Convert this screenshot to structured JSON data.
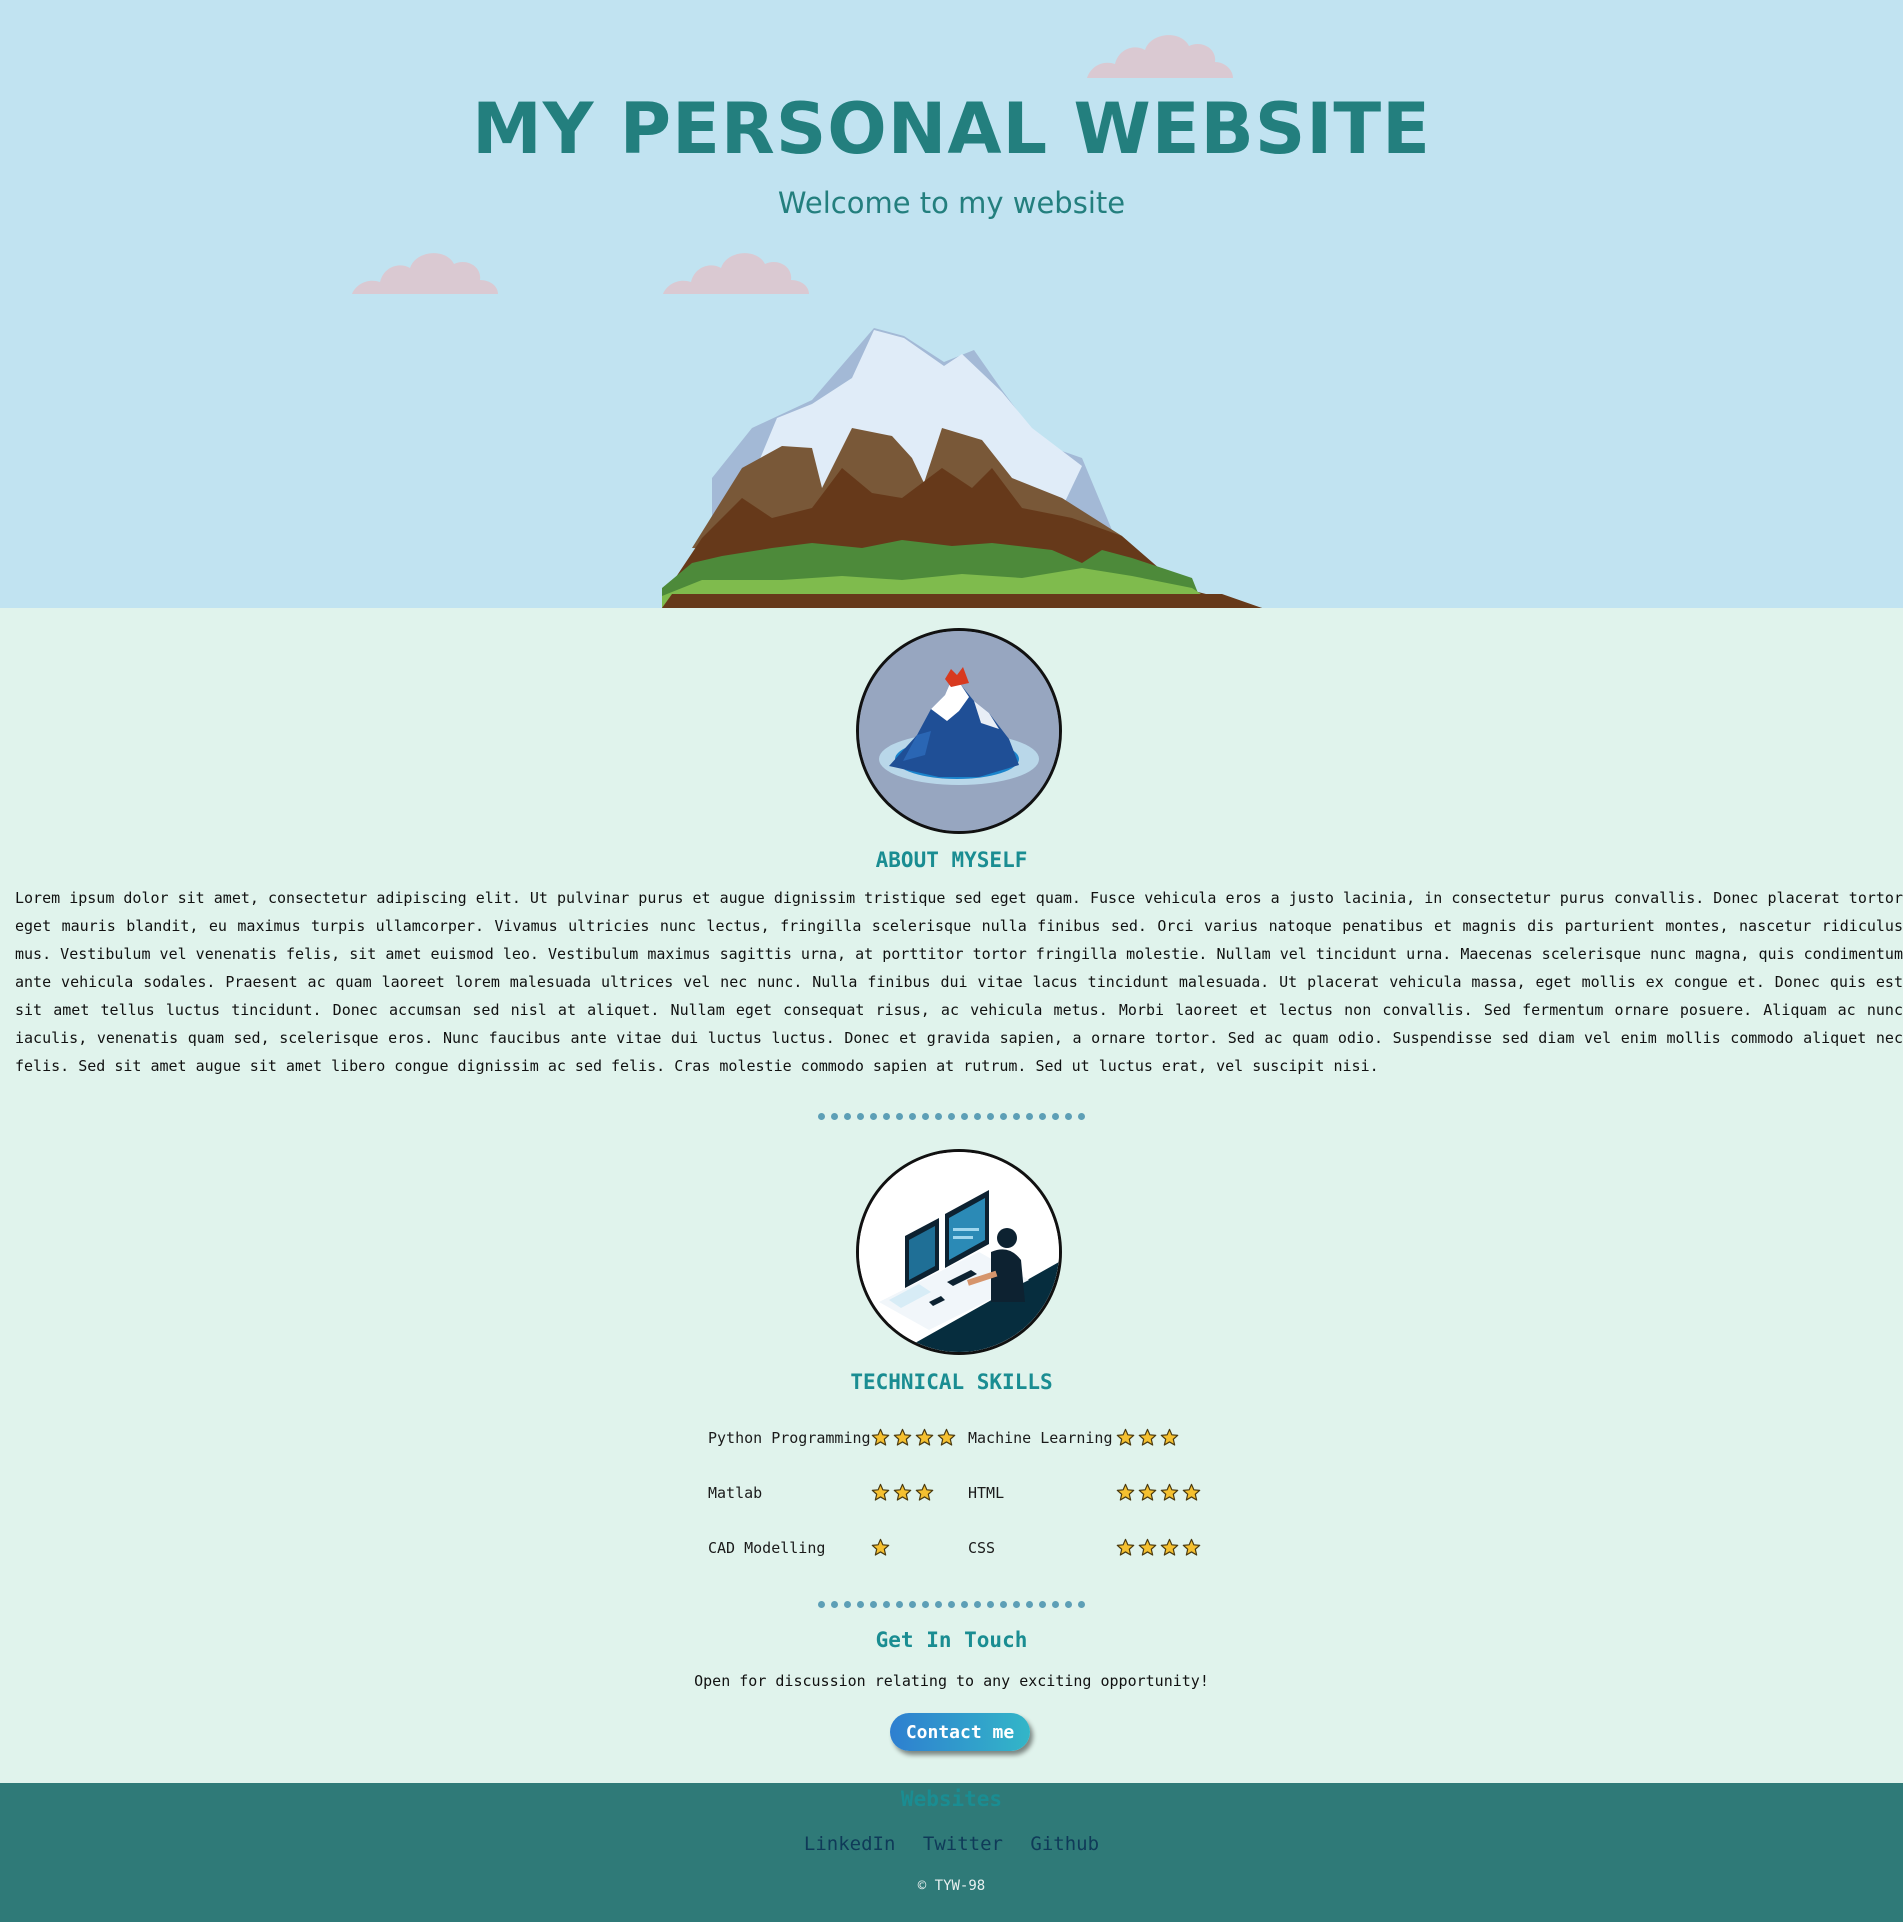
{
  "hero": {
    "title": "MY PERSONAL WEBSITE",
    "subtitle": "Welcome to my website"
  },
  "about": {
    "heading": "ABOUT MYSELF",
    "text": "Lorem ipsum dolor sit amet, consectetur adipiscing elit. Ut pulvinar purus et augue dignissim tristique sed eget quam. Fusce vehicula eros a justo lacinia, in consectetur purus convallis. Donec placerat tortor eget mauris blandit, eu maximus turpis ullamcorper. Vivamus ultricies nunc lectus, fringilla scelerisque nulla finibus sed. Orci varius natoque penatibus et magnis dis parturient montes, nascetur ridiculus mus. Vestibulum vel venenatis felis, sit amet euismod leo. Vestibulum maximus sagittis urna, at porttitor tortor fringilla molestie. Nullam vel tincidunt urna. Maecenas scelerisque nunc magna, quis condimentum ante vehicula sodales. Praesent ac quam laoreet lorem malesuada ultrices vel nec nunc. Nulla finibus dui vitae lacus tincidunt malesuada. Ut placerat vehicula massa, eget mollis ex congue et. Donec quis est sit amet tellus luctus tincidunt. Donec accumsan sed nisl at aliquet. Nullam eget consequat risus, ac vehicula metus. Morbi laoreet et lectus non convallis. Sed fermentum ornare posuere. Aliquam ac nunc iaculis, venenatis quam sed, scelerisque eros. Nunc faucibus ante vitae dui luctus luctus. Donec et gravida sapien, a ornare tortor. Sed ac quam odio. Suspendisse sed diam vel enim mollis commodo aliquet nec felis. Sed sit amet augue sit amet libero congue dignissim ac sed felis. Cras molestie commodo sapien at rutrum. Sed ut luctus erat, vel suscipit nisi."
  },
  "skills": {
    "heading": "TECHNICAL SKILLS",
    "rows": [
      [
        {
          "name": "Python Programming",
          "stars": 4
        },
        {
          "name": "Machine Learning",
          "stars": 3
        }
      ],
      [
        {
          "name": "Matlab",
          "stars": 3
        },
        {
          "name": "HTML",
          "stars": 4
        }
      ],
      [
        {
          "name": "CAD Modelling",
          "stars": 1
        },
        {
          "name": "CSS",
          "stars": 4
        }
      ]
    ]
  },
  "contact": {
    "heading": "Get In Touch",
    "text": "Open for discussion relating to any exciting opportunity!",
    "button_label": "Contact me"
  },
  "footer": {
    "heading": "Websites",
    "links": [
      "LinkedIn",
      "Twitter",
      "Github"
    ],
    "copyright": "© TYW-98"
  },
  "colors": {
    "sky": "#c1e3f1",
    "page_bg": "#e0f3ec",
    "accent_teal": "#237f7e",
    "heading_teal": "#1a8d92",
    "footer_bg": "#2f7a78"
  },
  "icons": [
    "cloud-icon",
    "mountain-illustration",
    "mountain-avatar",
    "developer-avatar",
    "star-icon"
  ]
}
